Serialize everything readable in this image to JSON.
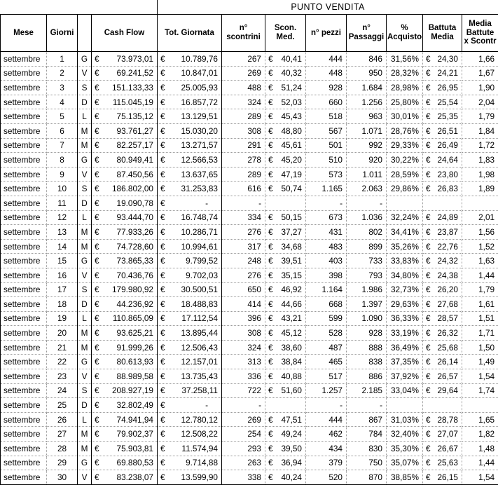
{
  "banner": {
    "title": "PUNTO VENDITA"
  },
  "headers": {
    "mese": "Mese",
    "giorni": "Giorni",
    "giorno_lettera": "",
    "cash_flow": "Cash Flow",
    "tot_giornata": "Tot. Giornata",
    "n_scontrini": "n° scontrini",
    "scon_med": "Scon. Med.",
    "n_pezzi": "n° pezzi",
    "n_passaggi": "n° Passaggi",
    "perc_acquisto": "% Acquisto",
    "battuta_media": "Battuta Media",
    "media_battute": "Media Battute x Scontr"
  },
  "currency_symbol": "€",
  "chart_data": {
    "type": "table",
    "title": "PUNTO VENDITA",
    "columns": [
      "Mese",
      "Giorni",
      "",
      "Cash Flow",
      "Tot. Giornata",
      "n° scontrini",
      "Scon. Med.",
      "n° pezzi",
      "n° Passaggi",
      "% Acquisto",
      "Battuta Media",
      "Media Battute x Scontr"
    ],
    "rows": [
      [
        "settembre",
        "1",
        "G",
        "73.973,01",
        "10.789,76",
        "267",
        "40,41",
        "444",
        "846",
        "31,56%",
        "24,30",
        "1,66"
      ],
      [
        "settembre",
        "2",
        "V",
        "69.241,52",
        "10.847,01",
        "269",
        "40,32",
        "448",
        "950",
        "28,32%",
        "24,21",
        "1,67"
      ],
      [
        "settembre",
        "3",
        "S",
        "151.133,33",
        "25.005,93",
        "488",
        "51,24",
        "928",
        "1.684",
        "28,98%",
        "26,95",
        "1,90"
      ],
      [
        "settembre",
        "4",
        "D",
        "115.045,19",
        "16.857,72",
        "324",
        "52,03",
        "660",
        "1.256",
        "25,80%",
        "25,54",
        "2,04"
      ],
      [
        "settembre",
        "5",
        "L",
        "75.135,12",
        "13.129,51",
        "289",
        "45,43",
        "518",
        "963",
        "30,01%",
        "25,35",
        "1,79"
      ],
      [
        "settembre",
        "6",
        "M",
        "93.761,27",
        "15.030,20",
        "308",
        "48,80",
        "567",
        "1.071",
        "28,76%",
        "26,51",
        "1,84"
      ],
      [
        "settembre",
        "7",
        "M",
        "82.257,17",
        "13.271,57",
        "291",
        "45,61",
        "501",
        "992",
        "29,33%",
        "26,49",
        "1,72"
      ],
      [
        "settembre",
        "8",
        "G",
        "80.949,41",
        "12.566,53",
        "278",
        "45,20",
        "510",
        "920",
        "30,22%",
        "24,64",
        "1,83"
      ],
      [
        "settembre",
        "9",
        "V",
        "87.450,56",
        "13.637,65",
        "289",
        "47,19",
        "573",
        "1.011",
        "28,59%",
        "23,80",
        "1,98"
      ],
      [
        "settembre",
        "10",
        "S",
        "186.802,00",
        "31.253,83",
        "616",
        "50,74",
        "1.165",
        "2.063",
        "29,86%",
        "26,83",
        "1,89"
      ],
      [
        "settembre",
        "11",
        "D",
        "19.090,78",
        "-",
        "-",
        "",
        "-",
        "-",
        "",
        "",
        ""
      ],
      [
        "settembre",
        "12",
        "L",
        "93.444,70",
        "16.748,74",
        "334",
        "50,15",
        "673",
        "1.036",
        "32,24%",
        "24,89",
        "2,01"
      ],
      [
        "settembre",
        "13",
        "M",
        "77.933,26",
        "10.286,71",
        "276",
        "37,27",
        "431",
        "802",
        "34,41%",
        "23,87",
        "1,56"
      ],
      [
        "settembre",
        "14",
        "M",
        "74.728,60",
        "10.994,61",
        "317",
        "34,68",
        "483",
        "899",
        "35,26%",
        "22,76",
        "1,52"
      ],
      [
        "settembre",
        "15",
        "G",
        "73.865,33",
        "9.799,52",
        "248",
        "39,51",
        "403",
        "733",
        "33,83%",
        "24,32",
        "1,63"
      ],
      [
        "settembre",
        "16",
        "V",
        "70.436,76",
        "9.702,03",
        "276",
        "35,15",
        "398",
        "793",
        "34,80%",
        "24,38",
        "1,44"
      ],
      [
        "settembre",
        "17",
        "S",
        "179.980,92",
        "30.500,51",
        "650",
        "46,92",
        "1.164",
        "1.986",
        "32,73%",
        "26,20",
        "1,79"
      ],
      [
        "settembre",
        "18",
        "D",
        "44.236,92",
        "18.488,83",
        "414",
        "44,66",
        "668",
        "1.397",
        "29,63%",
        "27,68",
        "1,61"
      ],
      [
        "settembre",
        "19",
        "L",
        "110.865,09",
        "17.112,54",
        "396",
        "43,21",
        "599",
        "1.090",
        "36,33%",
        "28,57",
        "1,51"
      ],
      [
        "settembre",
        "20",
        "M",
        "93.625,21",
        "13.895,44",
        "308",
        "45,12",
        "528",
        "928",
        "33,19%",
        "26,32",
        "1,71"
      ],
      [
        "settembre",
        "21",
        "M",
        "91.999,26",
        "12.506,43",
        "324",
        "38,60",
        "487",
        "888",
        "36,49%",
        "25,68",
        "1,50"
      ],
      [
        "settembre",
        "22",
        "G",
        "80.613,93",
        "12.157,01",
        "313",
        "38,84",
        "465",
        "838",
        "37,35%",
        "26,14",
        "1,49"
      ],
      [
        "settembre",
        "23",
        "V",
        "88.989,58",
        "13.735,43",
        "336",
        "40,88",
        "517",
        "886",
        "37,92%",
        "26,57",
        "1,54"
      ],
      [
        "settembre",
        "24",
        "S",
        "208.927,19",
        "37.258,11",
        "722",
        "51,60",
        "1.257",
        "2.185",
        "33,04%",
        "29,64",
        "1,74"
      ],
      [
        "settembre",
        "25",
        "D",
        "32.802,49",
        "-",
        "-",
        "",
        "-",
        "-",
        "",
        "",
        ""
      ],
      [
        "settembre",
        "26",
        "L",
        "74.941,94",
        "12.780,12",
        "269",
        "47,51",
        "444",
        "867",
        "31,03%",
        "28,78",
        "1,65"
      ],
      [
        "settembre",
        "27",
        "M",
        "79.902,37",
        "12.508,22",
        "254",
        "49,24",
        "462",
        "784",
        "32,40%",
        "27,07",
        "1,82"
      ],
      [
        "settembre",
        "28",
        "M",
        "75.903,81",
        "11.574,94",
        "293",
        "39,50",
        "434",
        "830",
        "35,30%",
        "26,67",
        "1,48"
      ],
      [
        "settembre",
        "29",
        "G",
        "69.880,53",
        "9.714,88",
        "263",
        "36,94",
        "379",
        "750",
        "35,07%",
        "25,63",
        "1,44"
      ],
      [
        "settembre",
        "30",
        "V",
        "83.238,07",
        "13.599,90",
        "338",
        "40,24",
        "520",
        "870",
        "38,85%",
        "26,15",
        "1,54"
      ]
    ]
  },
  "rows": [
    {
      "mese": "settembre",
      "giorno": "1",
      "lettera": "G",
      "cash_flow": "73.973,01",
      "tot_giornata": "10.789,76",
      "n_scontrini": "267",
      "scon_med": "40,41",
      "n_pezzi": "444",
      "n_passaggi": "846",
      "perc_acquisto": "31,56%",
      "battuta_media": "24,30",
      "media_battute": "1,66"
    },
    {
      "mese": "settembre",
      "giorno": "2",
      "lettera": "V",
      "cash_flow": "69.241,52",
      "tot_giornata": "10.847,01",
      "n_scontrini": "269",
      "scon_med": "40,32",
      "n_pezzi": "448",
      "n_passaggi": "950",
      "perc_acquisto": "28,32%",
      "battuta_media": "24,21",
      "media_battute": "1,67"
    },
    {
      "mese": "settembre",
      "giorno": "3",
      "lettera": "S",
      "cash_flow": "151.133,33",
      "tot_giornata": "25.005,93",
      "n_scontrini": "488",
      "scon_med": "51,24",
      "n_pezzi": "928",
      "n_passaggi": "1.684",
      "perc_acquisto": "28,98%",
      "battuta_media": "26,95",
      "media_battute": "1,90"
    },
    {
      "mese": "settembre",
      "giorno": "4",
      "lettera": "D",
      "cash_flow": "115.045,19",
      "tot_giornata": "16.857,72",
      "n_scontrini": "324",
      "scon_med": "52,03",
      "n_pezzi": "660",
      "n_passaggi": "1.256",
      "perc_acquisto": "25,80%",
      "battuta_media": "25,54",
      "media_battute": "2,04"
    },
    {
      "mese": "settembre",
      "giorno": "5",
      "lettera": "L",
      "cash_flow": "75.135,12",
      "tot_giornata": "13.129,51",
      "n_scontrini": "289",
      "scon_med": "45,43",
      "n_pezzi": "518",
      "n_passaggi": "963",
      "perc_acquisto": "30,01%",
      "battuta_media": "25,35",
      "media_battute": "1,79"
    },
    {
      "mese": "settembre",
      "giorno": "6",
      "lettera": "M",
      "cash_flow": "93.761,27",
      "tot_giornata": "15.030,20",
      "n_scontrini": "308",
      "scon_med": "48,80",
      "n_pezzi": "567",
      "n_passaggi": "1.071",
      "perc_acquisto": "28,76%",
      "battuta_media": "26,51",
      "media_battute": "1,84"
    },
    {
      "mese": "settembre",
      "giorno": "7",
      "lettera": "M",
      "cash_flow": "82.257,17",
      "tot_giornata": "13.271,57",
      "n_scontrini": "291",
      "scon_med": "45,61",
      "n_pezzi": "501",
      "n_passaggi": "992",
      "perc_acquisto": "29,33%",
      "battuta_media": "26,49",
      "media_battute": "1,72"
    },
    {
      "mese": "settembre",
      "giorno": "8",
      "lettera": "G",
      "cash_flow": "80.949,41",
      "tot_giornata": "12.566,53",
      "n_scontrini": "278",
      "scon_med": "45,20",
      "n_pezzi": "510",
      "n_passaggi": "920",
      "perc_acquisto": "30,22%",
      "battuta_media": "24,64",
      "media_battute": "1,83"
    },
    {
      "mese": "settembre",
      "giorno": "9",
      "lettera": "V",
      "cash_flow": "87.450,56",
      "tot_giornata": "13.637,65",
      "n_scontrini": "289",
      "scon_med": "47,19",
      "n_pezzi": "573",
      "n_passaggi": "1.011",
      "perc_acquisto": "28,59%",
      "battuta_media": "23,80",
      "media_battute": "1,98"
    },
    {
      "mese": "settembre",
      "giorno": "10",
      "lettera": "S",
      "cash_flow": "186.802,00",
      "tot_giornata": "31.253,83",
      "n_scontrini": "616",
      "scon_med": "50,74",
      "n_pezzi": "1.165",
      "n_passaggi": "2.063",
      "perc_acquisto": "29,86%",
      "battuta_media": "26,83",
      "media_battute": "1,89"
    },
    {
      "mese": "settembre",
      "giorno": "11",
      "lettera": "D",
      "cash_flow": "19.090,78",
      "tot_giornata": "-",
      "n_scontrini": "-",
      "scon_med": "",
      "n_pezzi": "-",
      "n_passaggi": "-",
      "perc_acquisto": "",
      "battuta_media": "",
      "media_battute": ""
    },
    {
      "mese": "settembre",
      "giorno": "12",
      "lettera": "L",
      "cash_flow": "93.444,70",
      "tot_giornata": "16.748,74",
      "n_scontrini": "334",
      "scon_med": "50,15",
      "n_pezzi": "673",
      "n_passaggi": "1.036",
      "perc_acquisto": "32,24%",
      "battuta_media": "24,89",
      "media_battute": "2,01"
    },
    {
      "mese": "settembre",
      "giorno": "13",
      "lettera": "M",
      "cash_flow": "77.933,26",
      "tot_giornata": "10.286,71",
      "n_scontrini": "276",
      "scon_med": "37,27",
      "n_pezzi": "431",
      "n_passaggi": "802",
      "perc_acquisto": "34,41%",
      "battuta_media": "23,87",
      "media_battute": "1,56"
    },
    {
      "mese": "settembre",
      "giorno": "14",
      "lettera": "M",
      "cash_flow": "74.728,60",
      "tot_giornata": "10.994,61",
      "n_scontrini": "317",
      "scon_med": "34,68",
      "n_pezzi": "483",
      "n_passaggi": "899",
      "perc_acquisto": "35,26%",
      "battuta_media": "22,76",
      "media_battute": "1,52"
    },
    {
      "mese": "settembre",
      "giorno": "15",
      "lettera": "G",
      "cash_flow": "73.865,33",
      "tot_giornata": "9.799,52",
      "n_scontrini": "248",
      "scon_med": "39,51",
      "n_pezzi": "403",
      "n_passaggi": "733",
      "perc_acquisto": "33,83%",
      "battuta_media": "24,32",
      "media_battute": "1,63"
    },
    {
      "mese": "settembre",
      "giorno": "16",
      "lettera": "V",
      "cash_flow": "70.436,76",
      "tot_giornata": "9.702,03",
      "n_scontrini": "276",
      "scon_med": "35,15",
      "n_pezzi": "398",
      "n_passaggi": "793",
      "perc_acquisto": "34,80%",
      "battuta_media": "24,38",
      "media_battute": "1,44"
    },
    {
      "mese": "settembre",
      "giorno": "17",
      "lettera": "S",
      "cash_flow": "179.980,92",
      "tot_giornata": "30.500,51",
      "n_scontrini": "650",
      "scon_med": "46,92",
      "n_pezzi": "1.164",
      "n_passaggi": "1.986",
      "perc_acquisto": "32,73%",
      "battuta_media": "26,20",
      "media_battute": "1,79"
    },
    {
      "mese": "settembre",
      "giorno": "18",
      "lettera": "D",
      "cash_flow": "44.236,92",
      "tot_giornata": "18.488,83",
      "n_scontrini": "414",
      "scon_med": "44,66",
      "n_pezzi": "668",
      "n_passaggi": "1.397",
      "perc_acquisto": "29,63%",
      "battuta_media": "27,68",
      "media_battute": "1,61"
    },
    {
      "mese": "settembre",
      "giorno": "19",
      "lettera": "L",
      "cash_flow": "110.865,09",
      "tot_giornata": "17.112,54",
      "n_scontrini": "396",
      "scon_med": "43,21",
      "n_pezzi": "599",
      "n_passaggi": "1.090",
      "perc_acquisto": "36,33%",
      "battuta_media": "28,57",
      "media_battute": "1,51"
    },
    {
      "mese": "settembre",
      "giorno": "20",
      "lettera": "M",
      "cash_flow": "93.625,21",
      "tot_giornata": "13.895,44",
      "n_scontrini": "308",
      "scon_med": "45,12",
      "n_pezzi": "528",
      "n_passaggi": "928",
      "perc_acquisto": "33,19%",
      "battuta_media": "26,32",
      "media_battute": "1,71"
    },
    {
      "mese": "settembre",
      "giorno": "21",
      "lettera": "M",
      "cash_flow": "91.999,26",
      "tot_giornata": "12.506,43",
      "n_scontrini": "324",
      "scon_med": "38,60",
      "n_pezzi": "487",
      "n_passaggi": "888",
      "perc_acquisto": "36,49%",
      "battuta_media": "25,68",
      "media_battute": "1,50"
    },
    {
      "mese": "settembre",
      "giorno": "22",
      "lettera": "G",
      "cash_flow": "80.613,93",
      "tot_giornata": "12.157,01",
      "n_scontrini": "313",
      "scon_med": "38,84",
      "n_pezzi": "465",
      "n_passaggi": "838",
      "perc_acquisto": "37,35%",
      "battuta_media": "26,14",
      "media_battute": "1,49"
    },
    {
      "mese": "settembre",
      "giorno": "23",
      "lettera": "V",
      "cash_flow": "88.989,58",
      "tot_giornata": "13.735,43",
      "n_scontrini": "336",
      "scon_med": "40,88",
      "n_pezzi": "517",
      "n_passaggi": "886",
      "perc_acquisto": "37,92%",
      "battuta_media": "26,57",
      "media_battute": "1,54"
    },
    {
      "mese": "settembre",
      "giorno": "24",
      "lettera": "S",
      "cash_flow": "208.927,19",
      "tot_giornata": "37.258,11",
      "n_scontrini": "722",
      "scon_med": "51,60",
      "n_pezzi": "1.257",
      "n_passaggi": "2.185",
      "perc_acquisto": "33,04%",
      "battuta_media": "29,64",
      "media_battute": "1,74"
    },
    {
      "mese": "settembre",
      "giorno": "25",
      "lettera": "D",
      "cash_flow": "32.802,49",
      "tot_giornata": "-",
      "n_scontrini": "-",
      "scon_med": "",
      "n_pezzi": "-",
      "n_passaggi": "-",
      "perc_acquisto": "",
      "battuta_media": "",
      "media_battute": ""
    },
    {
      "mese": "settembre",
      "giorno": "26",
      "lettera": "L",
      "cash_flow": "74.941,94",
      "tot_giornata": "12.780,12",
      "n_scontrini": "269",
      "scon_med": "47,51",
      "n_pezzi": "444",
      "n_passaggi": "867",
      "perc_acquisto": "31,03%",
      "battuta_media": "28,78",
      "media_battute": "1,65"
    },
    {
      "mese": "settembre",
      "giorno": "27",
      "lettera": "M",
      "cash_flow": "79.902,37",
      "tot_giornata": "12.508,22",
      "n_scontrini": "254",
      "scon_med": "49,24",
      "n_pezzi": "462",
      "n_passaggi": "784",
      "perc_acquisto": "32,40%",
      "battuta_media": "27,07",
      "media_battute": "1,82"
    },
    {
      "mese": "settembre",
      "giorno": "28",
      "lettera": "M",
      "cash_flow": "75.903,81",
      "tot_giornata": "11.574,94",
      "n_scontrini": "293",
      "scon_med": "39,50",
      "n_pezzi": "434",
      "n_passaggi": "830",
      "perc_acquisto": "35,30%",
      "battuta_media": "26,67",
      "media_battute": "1,48"
    },
    {
      "mese": "settembre",
      "giorno": "29",
      "lettera": "G",
      "cash_flow": "69.880,53",
      "tot_giornata": "9.714,88",
      "n_scontrini": "263",
      "scon_med": "36,94",
      "n_pezzi": "379",
      "n_passaggi": "750",
      "perc_acquisto": "35,07%",
      "battuta_media": "25,63",
      "media_battute": "1,44"
    },
    {
      "mese": "settembre",
      "giorno": "30",
      "lettera": "V",
      "cash_flow": "83.238,07",
      "tot_giornata": "13.599,90",
      "n_scontrini": "338",
      "scon_med": "40,24",
      "n_pezzi": "520",
      "n_passaggi": "870",
      "perc_acquisto": "38,85%",
      "battuta_media": "26,15",
      "media_battute": "1,54"
    }
  ]
}
